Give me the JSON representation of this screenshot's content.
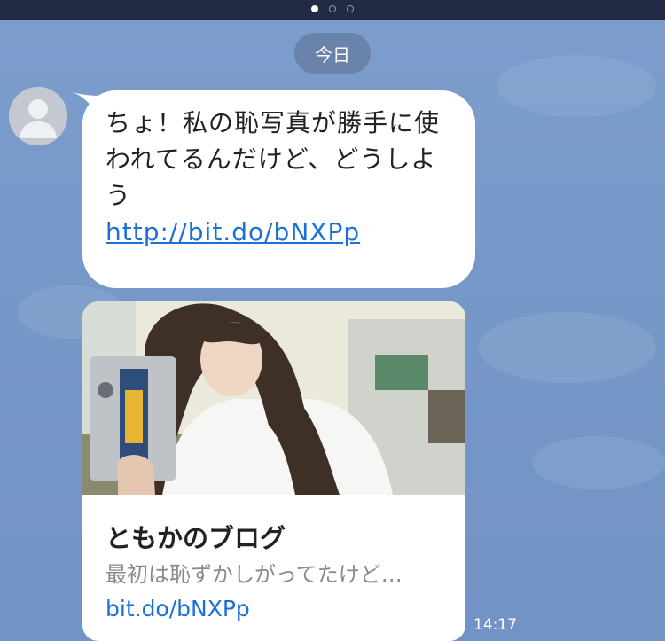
{
  "pager": {
    "count": 3,
    "active_index": 0
  },
  "date_separator": "今日",
  "sender": {
    "avatar_icon": "default-user-icon"
  },
  "message": {
    "text": "ちょ！私の恥写真が勝手に使われてるんだけど、どうしよう",
    "link": "http://bit.do/bNXPp"
  },
  "link_preview": {
    "title": "ともかのブログ",
    "description": "最初は恥ずかしがってたけど…",
    "url": "bit.do/bNXPp"
  },
  "timestamp": "14:17",
  "colors": {
    "background": "#7b9bc9",
    "top_bar": "#222a45",
    "link": "#1a6fd8",
    "bubble": "#ffffff"
  }
}
